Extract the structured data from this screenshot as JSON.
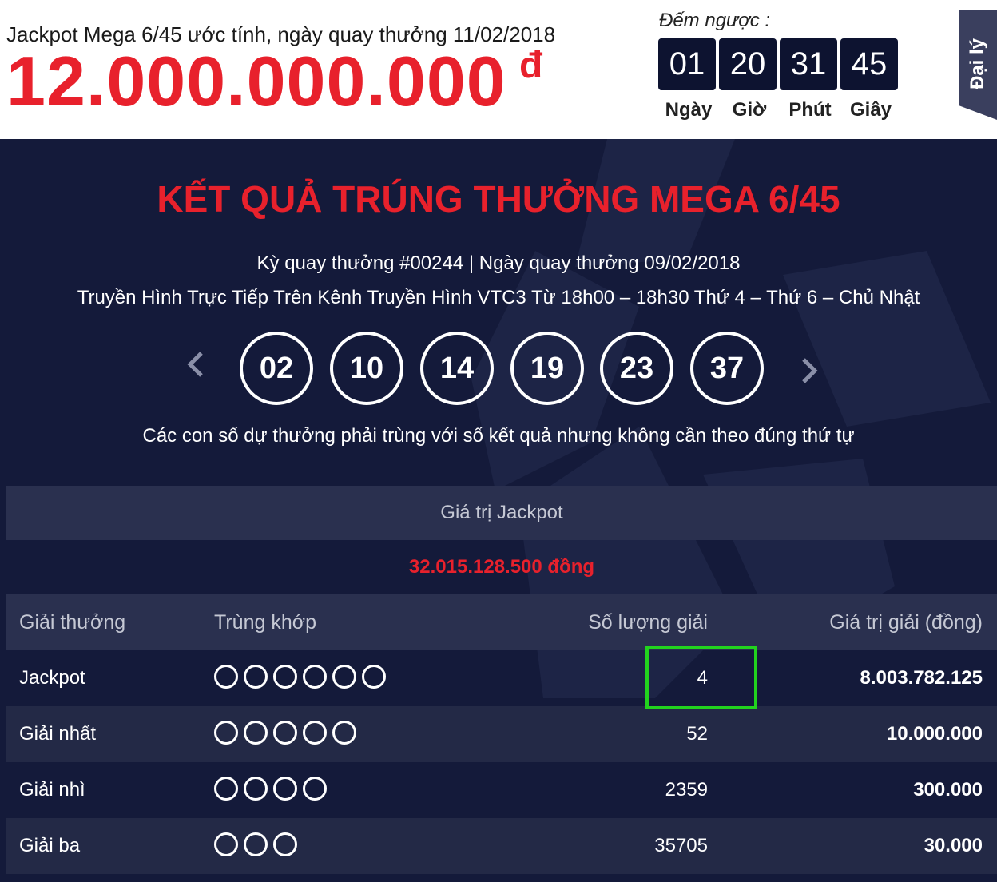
{
  "header": {
    "estimate_text": "Jackpot Mega 6/45 ước tính, ngày quay thưởng 11/02/2018",
    "jackpot_amount": "12.000.000.000",
    "currency_symbol": "đ"
  },
  "countdown": {
    "label": "Đếm ngược :",
    "units": [
      {
        "value": "01",
        "label": "Ngày"
      },
      {
        "value": "20",
        "label": "Giờ"
      },
      {
        "value": "31",
        "label": "Phút"
      },
      {
        "value": "45",
        "label": "Giây"
      }
    ]
  },
  "side_tab": {
    "label": "Đại lý"
  },
  "results": {
    "title": "KẾT QUẢ TRÚNG THƯỞNG MEGA 6/45",
    "draw_info": "Kỳ quay thưởng #00244 | Ngày quay thưởng 09/02/2018",
    "broadcast": "Truyền Hình Trực Tiếp Trên Kênh Truyền Hình VTC3 Từ 18h00 – 18h30 Thứ 4 – Thứ 6 – Chủ Nhật",
    "numbers": [
      "02",
      "10",
      "14",
      "19",
      "23",
      "37"
    ],
    "note": "Các con số dự thưởng phải trùng với số kết quả nhưng không cần theo đúng thứ tự"
  },
  "jackpot_value": {
    "label": "Giá trị Jackpot",
    "amount": "32.015.128.500 đồng"
  },
  "prize_table": {
    "columns": [
      "Giải thưởng",
      "Trùng khớp",
      "Số lượng giải",
      "Giá trị giải (đồng)"
    ],
    "rows": [
      {
        "prize": "Jackpot",
        "match_count": 6,
        "winners": "4",
        "value": "8.003.782.125"
      },
      {
        "prize": "Giải nhất",
        "match_count": 5,
        "winners": "52",
        "value": "10.000.000"
      },
      {
        "prize": "Giải nhì",
        "match_count": 4,
        "winners": "2359",
        "value": "300.000"
      },
      {
        "prize": "Giải ba",
        "match_count": 3,
        "winners": "35705",
        "value": "30.000"
      }
    ]
  },
  "colors": {
    "accent_red": "#e8212c",
    "panel_bg": "#141a3a",
    "highlight_green": "#22d31e"
  }
}
